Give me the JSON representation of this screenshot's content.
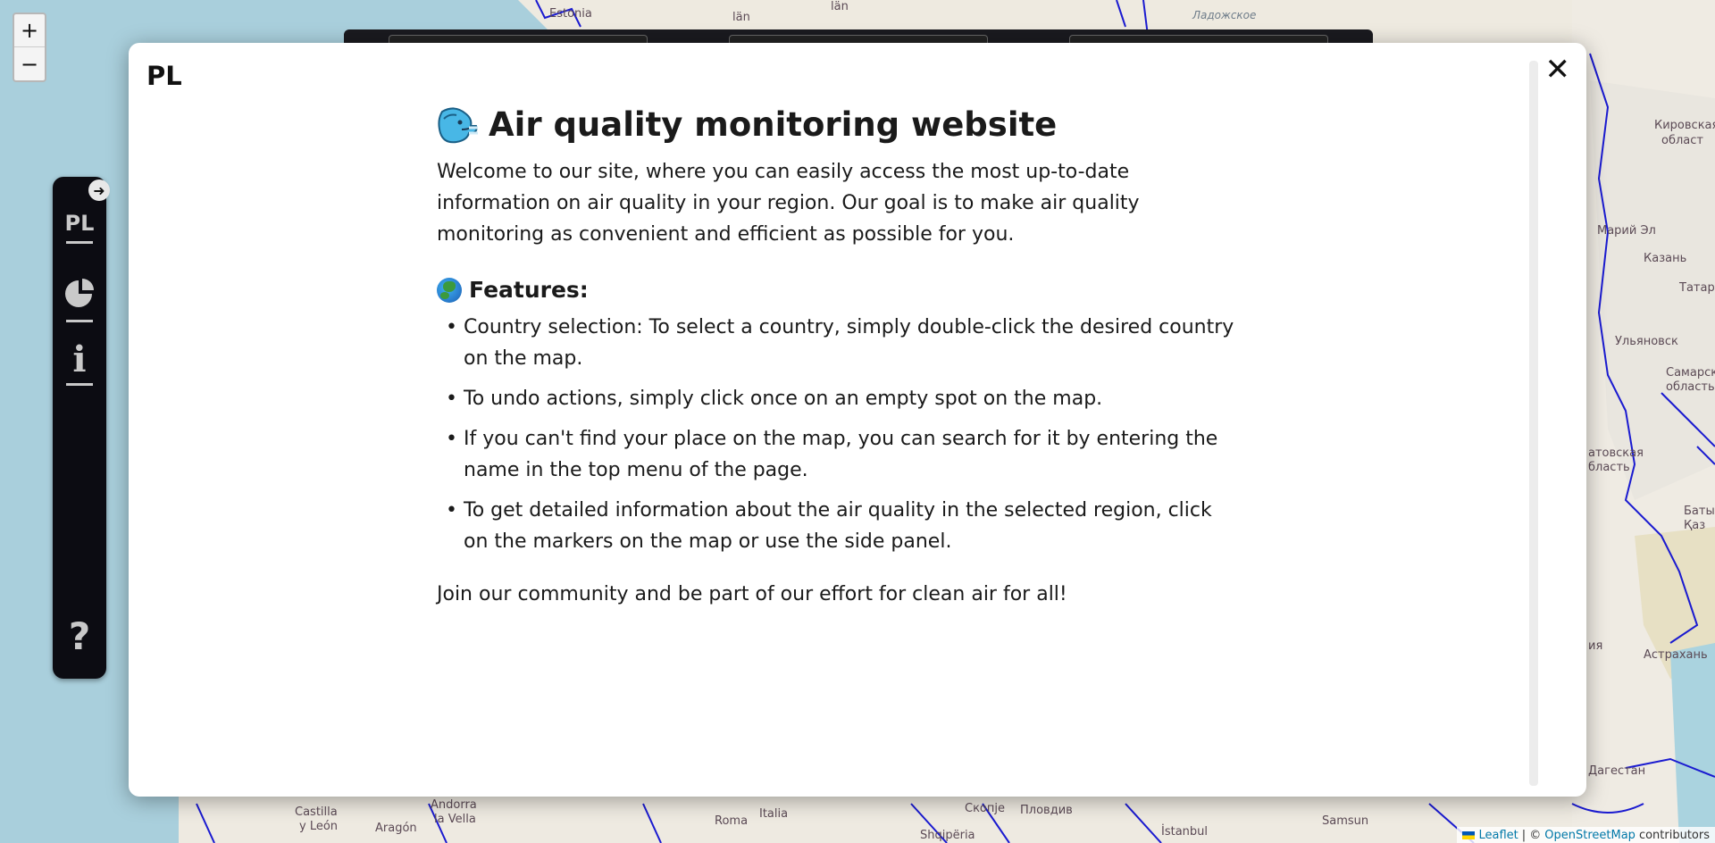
{
  "map": {
    "zoom_in": "+",
    "zoom_out": "−",
    "labels": {
      "estonia": "Estonia",
      "lan": "län",
      "lan2": "län",
      "ladozhskoe": "Ладожское",
      "kirov_oblast": "Кировская",
      "oblast1": "област",
      "mari_el": "Марий Эл",
      "kazan": "Казань",
      "tatar": "Татарс",
      "ulyanovsk": "Ульяновск",
      "samara": "Самарск",
      "oblast2": "область",
      "saratov": "атовская",
      "oblast3": "бласть",
      "batys": "Батыс",
      "kaz": "Қаз",
      "astrakhan": "Астрахань",
      "dagestan": "Дагестан",
      "andorra": "Andorra",
      "la_vella": "la Vella",
      "castilla": "Castilla",
      "y_leon": "y León",
      "aragon": "Aragón",
      "roma": "Roma",
      "italia": "Italia",
      "skopje": "Скопје",
      "plovdiv": "Пловдив",
      "shqiperia": "Shqipëria",
      "istanbul": "İstanbul",
      "samsun": "Samsun",
      "ia": "ия"
    }
  },
  "side_panel": {
    "toggle_icon": "➜",
    "lang": "PL",
    "info": "i",
    "help": "?"
  },
  "attribution": {
    "leaflet": "Leaflet",
    "separator": "| ©",
    "osm": "OpenStreetMap",
    "contributors": "contributors"
  },
  "modal": {
    "lang": "PL",
    "close": "✕",
    "title": "Air quality monitoring website",
    "intro": "Welcome to our site, where you can easily access the most up-to-date information on air quality in your region. Our goal is to make air quality monitoring as convenient and efficient as possible for you.",
    "features_heading": "Features:",
    "bullet": "•",
    "features": [
      "Country selection: To select a country, simply double-click the desired country on the map.",
      "To undo actions, simply click once on an empty spot on the map.",
      "If you can't find your place on the map, you can search for it by entering the name in the top menu of the page.",
      "To get detailed information about the air quality in the selected region, click on the markers on the map or use the side panel."
    ],
    "closing": "Join our community and be part of our effort for clean air for all!"
  },
  "colors": {
    "sea": "#a9cfdc",
    "land": "#f0ece4",
    "border": "#1a1ad0",
    "panel": "#0c0c12",
    "modal": "#ffffff"
  }
}
